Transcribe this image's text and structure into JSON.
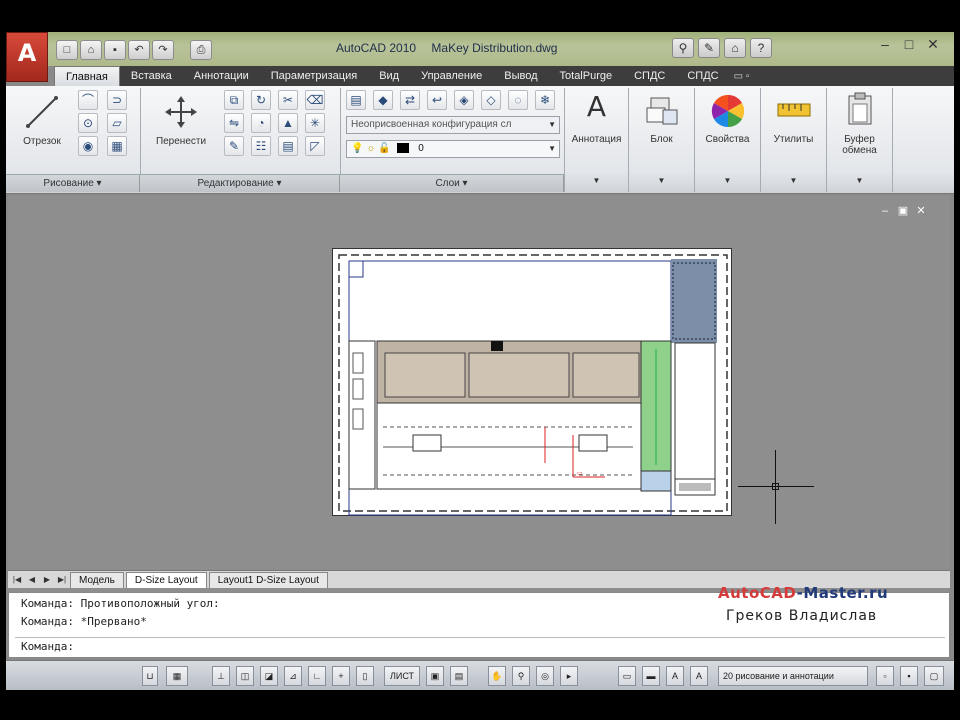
{
  "window": {
    "app_title": "AutoCAD 2010",
    "file_name": "MaKey Distribution.dwg"
  },
  "quick_access": [
    "new-icon",
    "open-icon",
    "save-icon",
    "undo-icon",
    "redo-icon",
    "plot-icon"
  ],
  "infocenter": [
    "binoculars-icon",
    "tools-icon",
    "home-icon",
    "help-icon"
  ],
  "ribbon_tabs": [
    {
      "label": "Главная",
      "active": true
    },
    {
      "label": "Вставка",
      "active": false
    },
    {
      "label": "Аннотации",
      "active": false
    },
    {
      "label": "Параметризация",
      "active": false
    },
    {
      "label": "Вид",
      "active": false
    },
    {
      "label": "Управление",
      "active": false
    },
    {
      "label": "Вывод",
      "active": false
    },
    {
      "label": "TotalPurge",
      "active": false
    },
    {
      "label": "СПДС",
      "active": false
    },
    {
      "label": "СПДС",
      "active": false
    }
  ],
  "ribbon": {
    "draw": {
      "line_label": "Отрезок",
      "panel_title": "Рисование ▾"
    },
    "modify": {
      "move_label": "Перенести",
      "panel_title": "Редактирование ▾"
    },
    "layers": {
      "combo_text": "Неоприсвоенная конфигурация сл",
      "layer_value": "0",
      "panel_title": "Слои ▾"
    },
    "annotation": {
      "label": "Аннотация"
    },
    "block": {
      "label": "Блок"
    },
    "properties": {
      "label": "Свойства"
    },
    "utilities": {
      "label": "Утилиты"
    },
    "clipboard": {
      "label": "Буфер обмена"
    }
  },
  "layout_tabs": [
    {
      "label": "Модель",
      "active": false
    },
    {
      "label": "D-Size Layout",
      "active": true
    },
    {
      "label": "Layout1 D-Size Layout",
      "active": false
    }
  ],
  "command_line": {
    "line1": "Команда: Противоположный угол:",
    "line2": "Команда: *Прервано*",
    "prompt": "Команда:"
  },
  "watermark": {
    "site_part1": "AutoCAD",
    "site_part2": "-Master.ru",
    "author": "Греков Владислав"
  },
  "status_bar": {
    "model_space": "ЛИСТ",
    "annotation_text": "20 рисование и аннотации"
  },
  "colors": {
    "ribbon_tab_bg": "#3d3d3d",
    "drawing_bg": "#8e8e8e",
    "watermark_red": "#d63b3b",
    "watermark_blue": "#203a7a"
  }
}
